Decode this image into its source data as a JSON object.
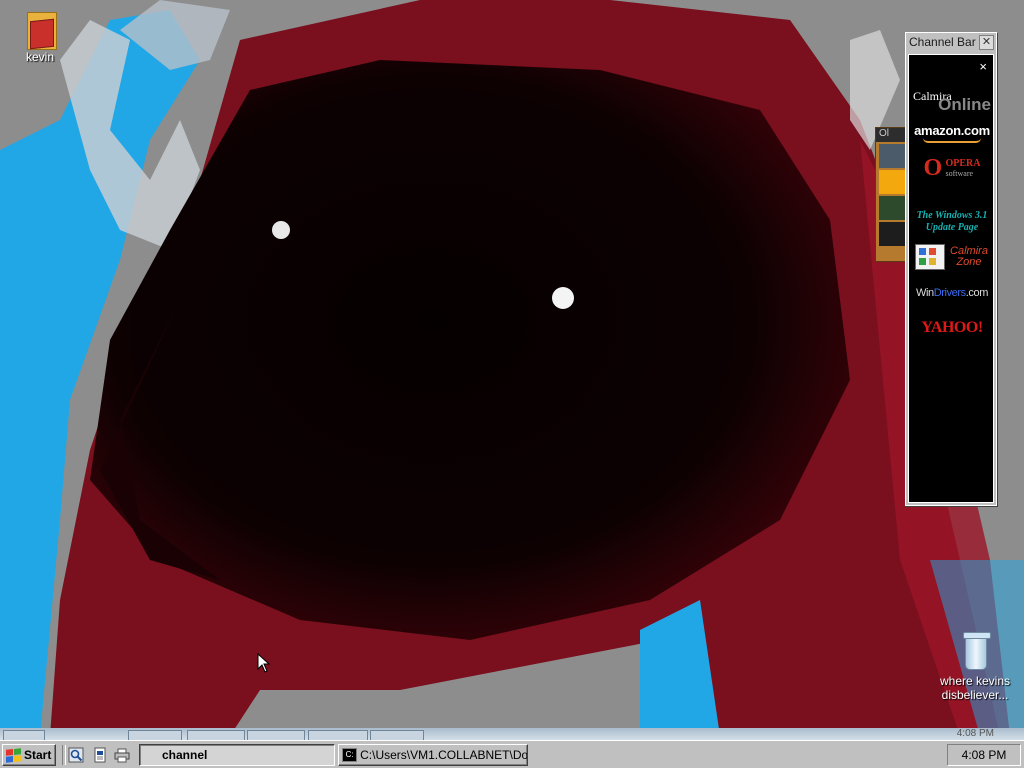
{
  "desktop": {
    "icons": [
      {
        "label": "kevin",
        "icon": "folder-icon"
      },
      {
        "label": "where kevins disbeliever...",
        "icon": "recycle-bin-icon"
      }
    ]
  },
  "channel_bar": {
    "title": "Channel Bar",
    "close_glyph": "✕",
    "panel_close_glyph": "×",
    "channels": {
      "calmira_online_small": "Calmira",
      "calmira_online_big": "Online",
      "amazon": "amazon.com",
      "opera_logo": "O",
      "opera_name": "OPERA",
      "opera_sub": "software",
      "win31_line1": "The Windows 3.1",
      "win31_line2": "Update Page",
      "calmira_zone_line1": "Calmira",
      "calmira_zone_line2": "Zone",
      "windrivers_part1": "Win",
      "windrivers_part2": "Drivers",
      "windrivers_part3": ".com",
      "yahoo": "YAHOO!"
    }
  },
  "background_window": {
    "title_fragment": "Ol"
  },
  "taskbar": {
    "start_label": "Start",
    "quick_launch": [
      "explorer-icon",
      "document-icon",
      "printer-icon"
    ],
    "tasks": [
      {
        "label": "channel",
        "active": true
      },
      {
        "label": "C:\\Users\\VM1.COLLABNET\\Do...",
        "active": false
      }
    ],
    "clock": "4:08 PM",
    "ghost_clock": "4:08 PM"
  },
  "colors": {
    "wallpaper_base": "#8f8f8f",
    "wallpaper_red": "#7a0f1e",
    "wallpaper_blue": "#21a7e6",
    "taskbar": "#c0c0c0",
    "channel_panel": "#000000"
  }
}
